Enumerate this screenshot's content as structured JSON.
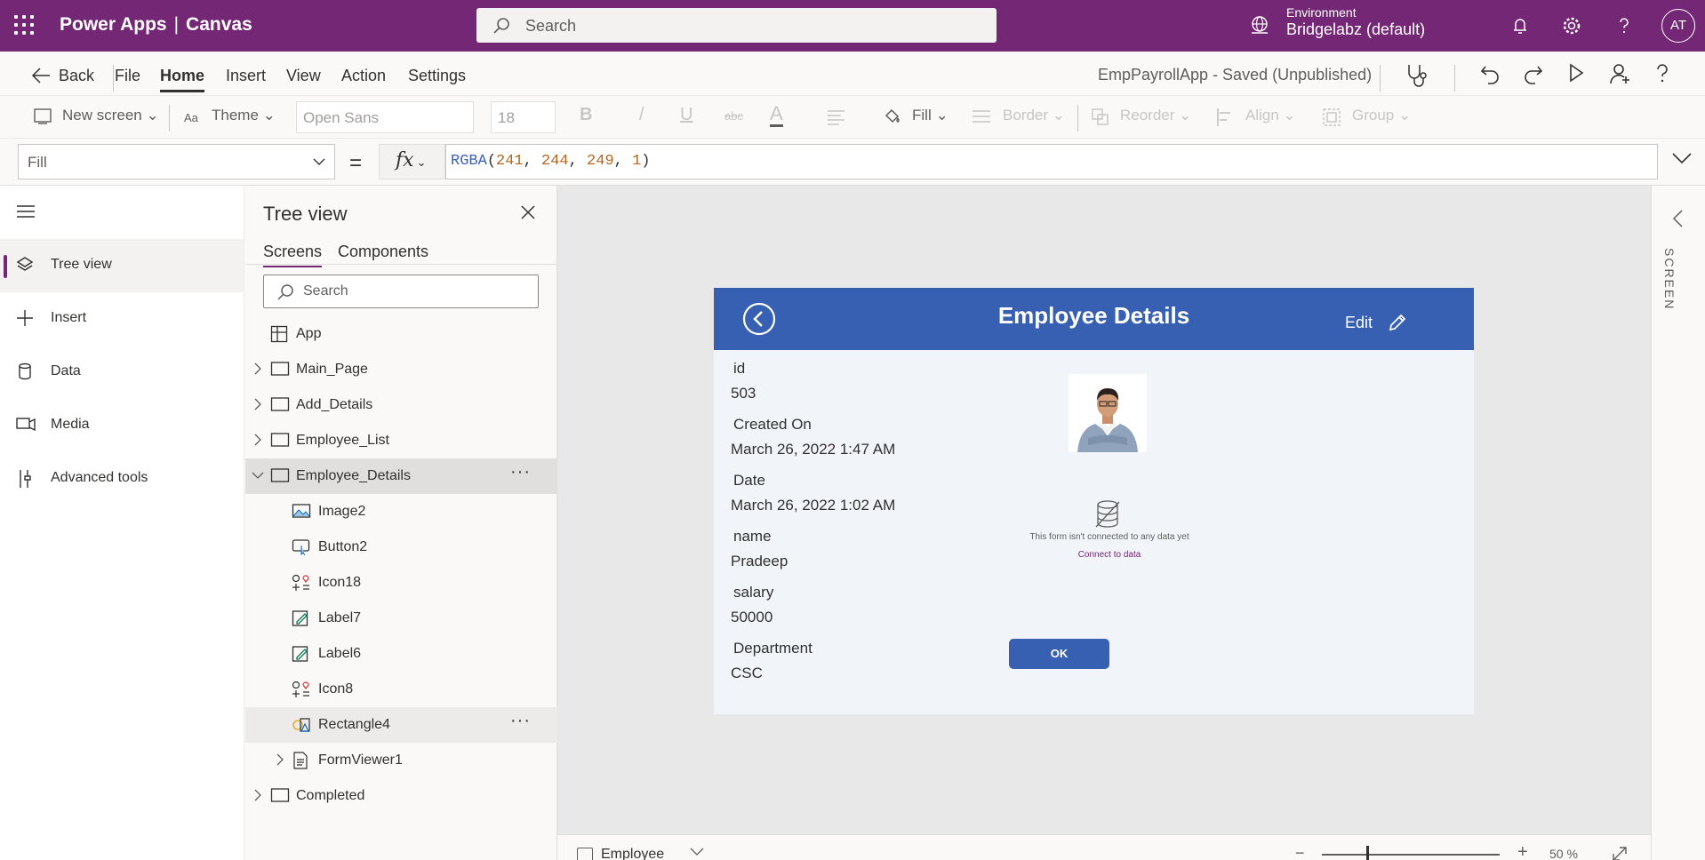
{
  "topbar": {
    "app_name": "Power Apps",
    "separator": "|",
    "app_type": "Canvas",
    "search_placeholder": "Search",
    "environment_label": "Environment",
    "environment_name": "Bridgelabz (default)",
    "avatar_initials": "AT"
  },
  "commandbar": {
    "back": "Back",
    "menu": [
      "File",
      "Home",
      "Insert",
      "View",
      "Action",
      "Settings"
    ],
    "active_menu": "Home",
    "app_title": "EmpPayrollApp - Saved (Unpublished)"
  },
  "ribbon": {
    "new_screen": "New screen",
    "theme": "Theme",
    "font": "Open Sans",
    "font_size": "18",
    "bold": "B",
    "italic": "/",
    "underline": "U",
    "strike": "abc",
    "font_color": "A",
    "fill": "Fill",
    "border": "Border",
    "reorder": "Reorder",
    "align": "Align",
    "group": "Group"
  },
  "formulabar": {
    "property": "Fill",
    "equals": "=",
    "fx": "fx",
    "formula_fn": "RGBA",
    "formula_args": [
      "241",
      "244",
      "249",
      "1"
    ],
    "fill_color": "#f1f4f9"
  },
  "leftnav": {
    "items": [
      {
        "label": "Tree view",
        "icon": "layers-icon",
        "active": true
      },
      {
        "label": "Insert",
        "icon": "plus-icon"
      },
      {
        "label": "Data",
        "icon": "database-icon"
      },
      {
        "label": "Media",
        "icon": "media-icon"
      },
      {
        "label": "Advanced tools",
        "icon": "tools-icon"
      }
    ]
  },
  "treeview": {
    "title": "Tree view",
    "tabs": [
      "Screens",
      "Components"
    ],
    "active_tab": "Screens",
    "search_placeholder": "Search",
    "app_node": "App",
    "nodes": [
      {
        "label": "Main_Page",
        "level": 0,
        "expanded": false
      },
      {
        "label": "Add_Details",
        "level": 0,
        "expanded": false
      },
      {
        "label": "Employee_List",
        "level": 0,
        "expanded": false
      },
      {
        "label": "Employee_Details",
        "level": 0,
        "expanded": true,
        "selected": true
      },
      {
        "label": "Image2",
        "level": 1
      },
      {
        "label": "Button2",
        "level": 1
      },
      {
        "label": "Icon18",
        "level": 1
      },
      {
        "label": "Label7",
        "level": 1
      },
      {
        "label": "Label6",
        "level": 1
      },
      {
        "label": "Icon8",
        "level": 1
      },
      {
        "label": "Rectangle4",
        "level": 1,
        "hovered": true
      },
      {
        "label": "FormViewer1",
        "level": 1,
        "expanded": false
      },
      {
        "label": "Completed",
        "level": 0,
        "expanded": false
      }
    ]
  },
  "screen": {
    "title": "Employee Details",
    "edit_label": "Edit",
    "header_color": "#3860b2",
    "fields": [
      {
        "label": "id",
        "value": "503"
      },
      {
        "label": "Created On",
        "value": "March 26, 2022 1:47 AM"
      },
      {
        "label": "Date",
        "value": "March 26, 2022 1:02 AM"
      },
      {
        "label": "name",
        "value": "Pradeep"
      },
      {
        "label": "salary",
        "value": "50000"
      },
      {
        "label": "Department",
        "value": "CSC"
      }
    ],
    "form_message": "This form isn't connected to any data yet",
    "form_link": "Connect to data",
    "ok_button": "OK"
  },
  "statusbar": {
    "screen_name": "Employee",
    "zoom_minus": "−",
    "zoom_plus": "+",
    "zoom": "50 %"
  },
  "rightpanel": {
    "label": "SCREEN"
  }
}
